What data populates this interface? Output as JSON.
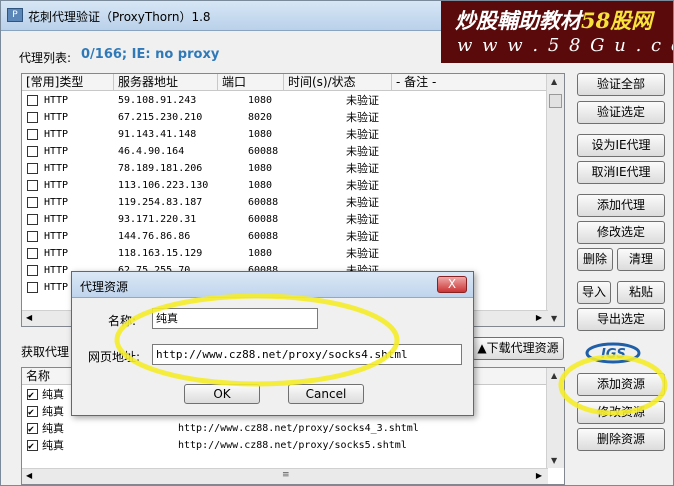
{
  "window": {
    "title": "花刺代理验证（ProxyThorn）1.8"
  },
  "watermark": {
    "line1_a": "炒股輔助教材",
    "line1_b": "58股网",
    "line2": "w w w . 5 8 G u . c o m"
  },
  "proxy_section": {
    "label": "代理列表:",
    "status": "0/166;   IE: no proxy"
  },
  "proxy_table": {
    "headers": [
      "[常用]类型",
      "服务器地址",
      "端口",
      "时间(s)/状态",
      "- 备注 -"
    ],
    "rows": [
      {
        "type": "HTTP",
        "ip": "59.108.91.243",
        "port": "1080",
        "status": "未验证"
      },
      {
        "type": "HTTP",
        "ip": "67.215.230.210",
        "port": "8020",
        "status": "未验证"
      },
      {
        "type": "HTTP",
        "ip": "91.143.41.148",
        "port": "1080",
        "status": "未验证"
      },
      {
        "type": "HTTP",
        "ip": "46.4.90.164",
        "port": "60088",
        "status": "未验证"
      },
      {
        "type": "HTTP",
        "ip": "78.189.181.206",
        "port": "1080",
        "status": "未验证"
      },
      {
        "type": "HTTP",
        "ip": "113.106.223.130",
        "port": "1080",
        "status": "未验证"
      },
      {
        "type": "HTTP",
        "ip": "119.254.83.187",
        "port": "60088",
        "status": "未验证"
      },
      {
        "type": "HTTP",
        "ip": "93.171.220.31",
        "port": "60088",
        "status": "未验证"
      },
      {
        "type": "HTTP",
        "ip": "144.76.86.86",
        "port": "60088",
        "status": "未验证"
      },
      {
        "type": "HTTP",
        "ip": "118.163.15.129",
        "port": "1080",
        "status": "未验证"
      },
      {
        "type": "HTTP",
        "ip": "62.75.255.70",
        "port": "60088",
        "status": "未验证"
      },
      {
        "type": "HTTP",
        "ip": "",
        "port": "",
        "status": "未验证"
      }
    ]
  },
  "buttons": {
    "verify_all": "验证全部",
    "verify_selected": "验证选定",
    "set_ie_proxy": "设为IE代理",
    "cancel_ie_proxy": "取消IE代理",
    "add_proxy": "添加代理",
    "modify_selected": "修改选定",
    "delete": "删除",
    "clean": "清理",
    "import": "导入",
    "paste": "粘贴",
    "export_selected": "导出选定",
    "download_proxy_source": "▲下载代理资源",
    "add_source": "添加资源",
    "modify_source": "修改资源",
    "delete_source": "删除资源"
  },
  "fetch_section": {
    "label": "获取代理"
  },
  "source_table": {
    "header": "名称",
    "rows": [
      {
        "name": "纯真",
        "checked": true,
        "url": ""
      },
      {
        "name": "纯真",
        "checked": true,
        "url": ""
      },
      {
        "name": "纯真",
        "checked": true,
        "url": "http://www.cz88.net/proxy/socks4_3.shtml"
      },
      {
        "name": "纯真",
        "checked": true,
        "url": "http://www.cz88.net/proxy/socks5.shtml"
      }
    ]
  },
  "dialog": {
    "title": "代理资源",
    "close": "X",
    "name_label": "名称:",
    "name_value": "纯真",
    "url_label": "网页地址:",
    "url_value": "http://www.cz88.net/proxy/socks4.shtml",
    "ok": "OK",
    "cancel": "Cancel"
  },
  "colors": {
    "status_blue": "#2f79b8",
    "highlight_yellow": "#f4ec2a",
    "watermark_bg": "#5a0a0a"
  }
}
